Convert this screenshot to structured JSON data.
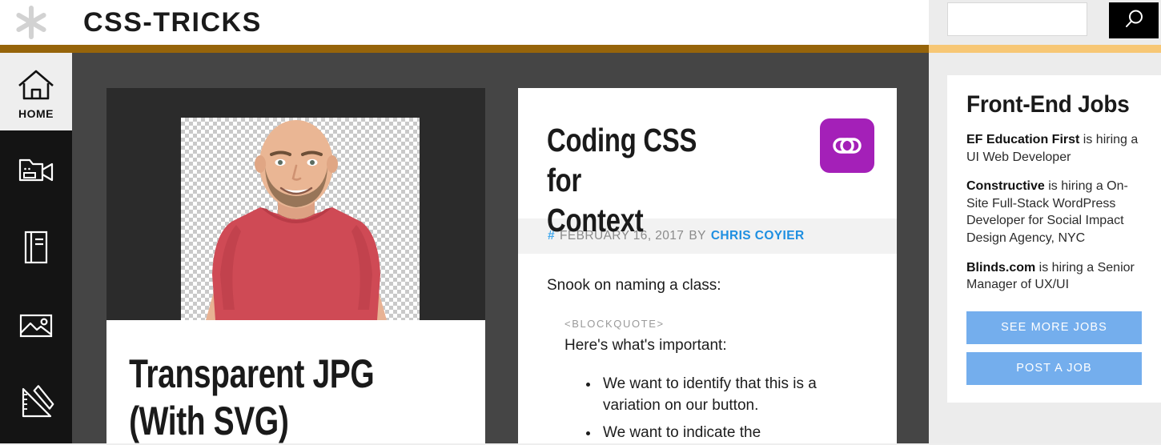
{
  "header": {
    "logo_icon": "asterisk-icon",
    "site_title": "CSS-TRICKS",
    "search": {
      "value": "",
      "placeholder": "",
      "button_icon": "search-icon"
    }
  },
  "sidebar": {
    "items": [
      {
        "label": "HOME",
        "icon": "home-icon",
        "active": true
      },
      {
        "label": "",
        "icon": "video-camera-icon",
        "active": false
      },
      {
        "label": "",
        "icon": "book-icon",
        "active": false
      },
      {
        "label": "",
        "icon": "image-icon",
        "active": false
      },
      {
        "label": "",
        "icon": "ruler-pencil-icon",
        "active": false
      }
    ]
  },
  "main": {
    "cards": [
      {
        "title": "Transparent JPG\n(With SVG)",
        "featured_image": "man-in-red-tshirt-on-transparency-checkerboard"
      },
      {
        "title": "Coding CSS for\nContext",
        "badge_icon": "link-chain-icon",
        "badge_color": "#a420b8",
        "meta": {
          "hash": "#",
          "date": "FEBRUARY 16, 2017",
          "by": "BY",
          "author": "CHRIS COYIER"
        },
        "body": {
          "intro": "Snook on naming a class:",
          "blockquote_tag": "<BLOCKQUOTE>",
          "quote_lead": "Here's what's important:",
          "quote_items": [
            "We want to identify that this is a variation on our button.",
            "We want to indicate the"
          ]
        }
      }
    ]
  },
  "right_rail": {
    "jobs": {
      "title": "Front-End Jobs",
      "listings": [
        {
          "company": "EF Education First",
          "text": " is hiring a UI Web Developer"
        },
        {
          "company": "Constructive",
          "text": " is hiring a On-Site Full-Stack WordPress Developer for Social Impact Design Agency, NYC"
        },
        {
          "company": "Blinds.com",
          "text": " is hiring a Senior Manager of UX/UI"
        }
      ],
      "buttons": [
        {
          "label": "SEE MORE JOBS"
        },
        {
          "label": "POST A JOB"
        }
      ]
    }
  },
  "colors": {
    "stripe_dark": "#96640a",
    "stripe_light": "#f7c775",
    "content_bg": "#454545",
    "sidebar_bg": "#141414",
    "accent_blue": "#1e8fe1",
    "button_blue": "#74aeed",
    "badge_purple": "#a420b8"
  }
}
